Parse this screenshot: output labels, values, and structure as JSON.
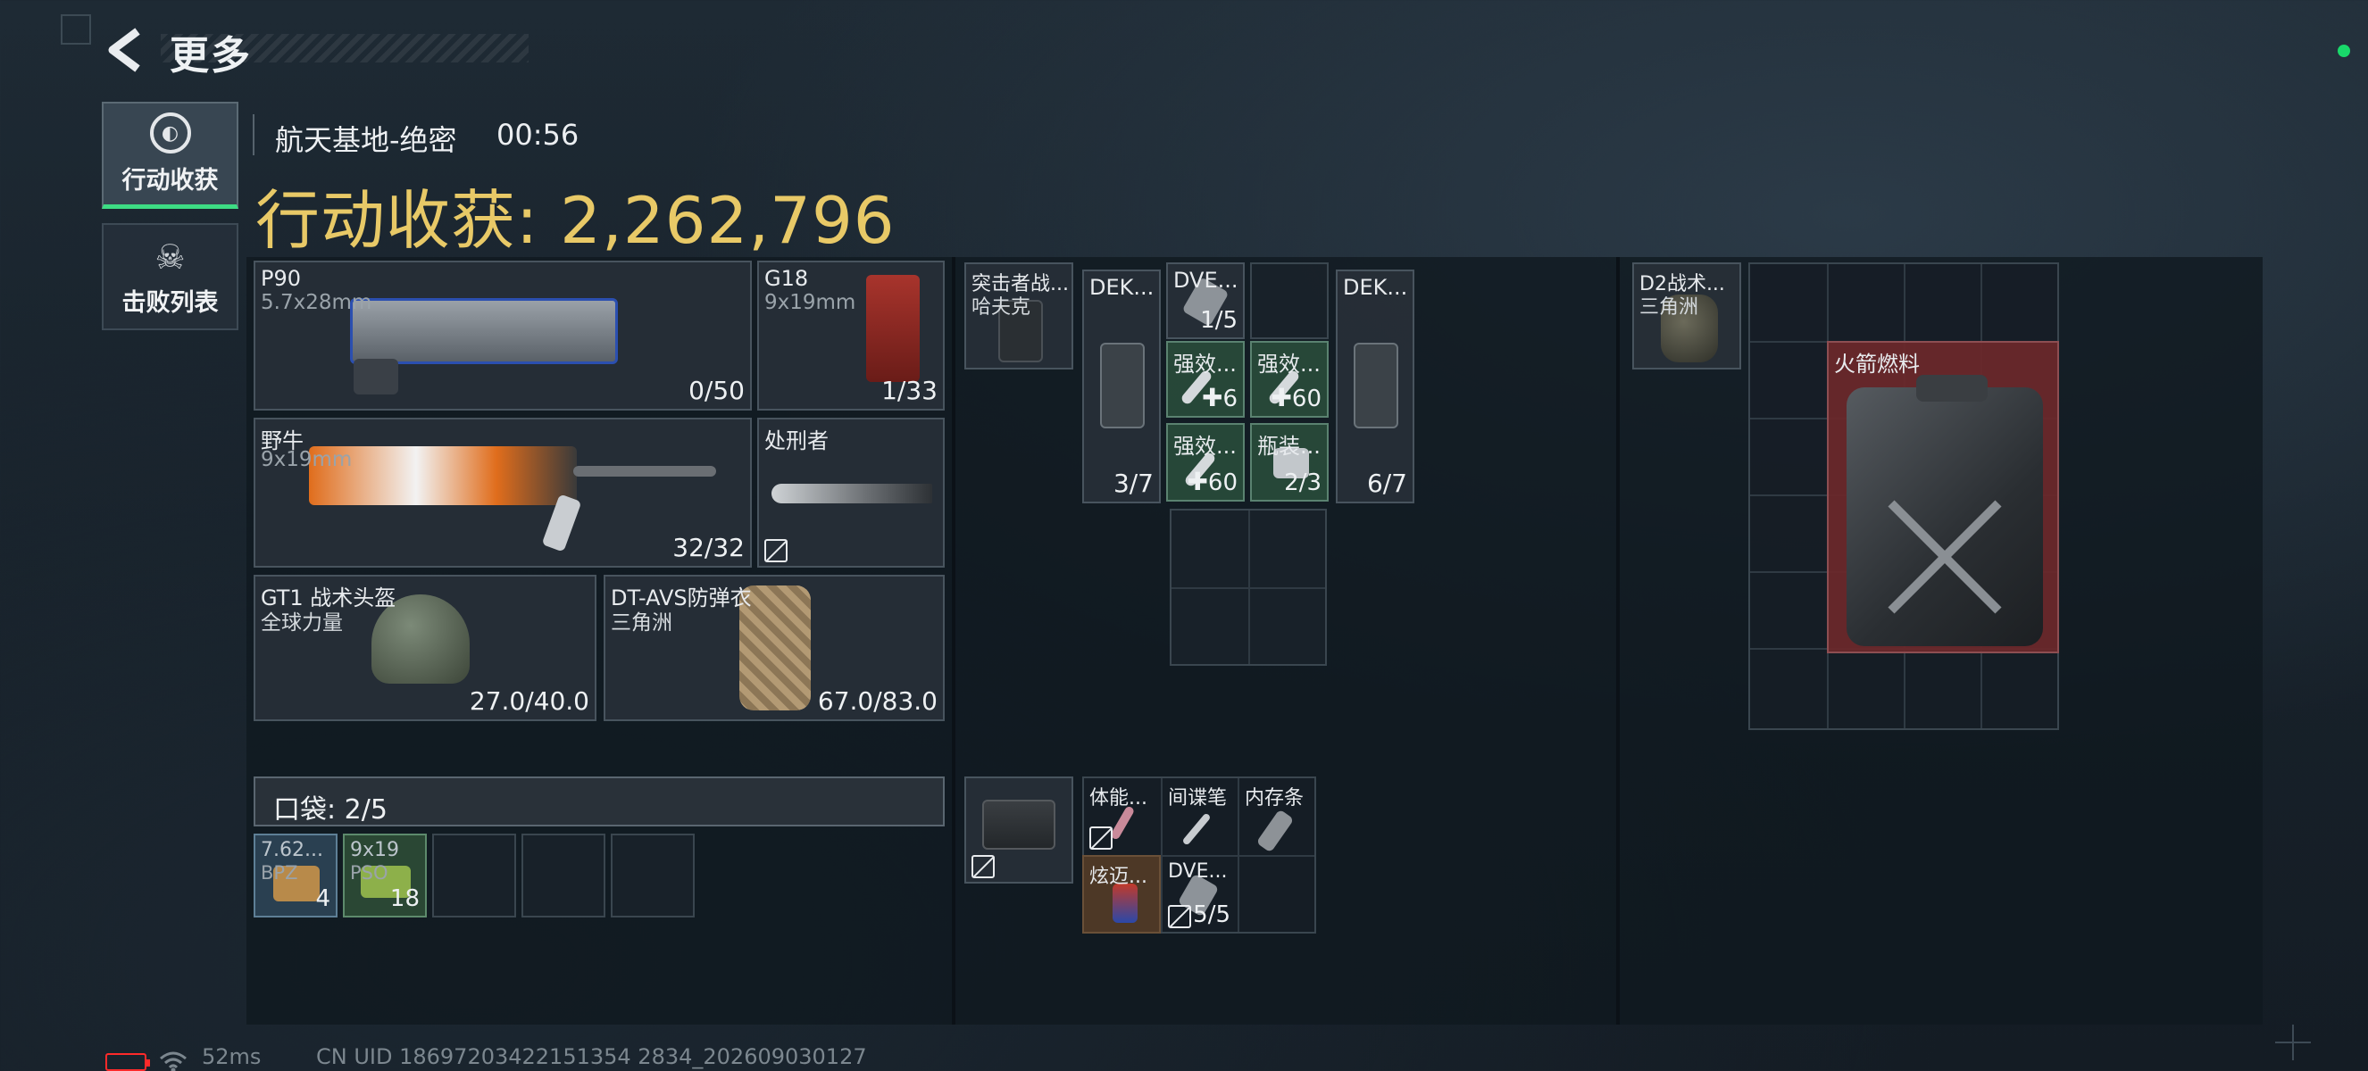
{
  "header": {
    "back_icon": "chevron-left-icon",
    "title": "更多"
  },
  "side_tabs": [
    {
      "label": "行动收获",
      "icon": "loot-icon",
      "active": true
    },
    {
      "label": "击败列表",
      "icon": "skull-icon",
      "active": false
    }
  ],
  "match": {
    "map": "航天基地-绝密",
    "time": "00:56"
  },
  "gains": {
    "title": "行动收获: 2,262,796"
  },
  "weapons": [
    {
      "name": "P90",
      "ammo": "5.7x28mm",
      "count": "0/50"
    },
    {
      "name": "G18",
      "ammo": "9x19mm",
      "count": "1/33"
    },
    {
      "name": "野牛",
      "ammo": "9x19mm",
      "count": "32/32"
    },
    {
      "name": "处刑者",
      "ammo": "",
      "count": ""
    }
  ],
  "armor": [
    {
      "name": "GT1 战术头盔",
      "maker": "全球力量",
      "durability": "27.0/40.0"
    },
    {
      "name": "DT-AVS防弹衣",
      "maker": "三角洲",
      "durability": "67.0/83.0"
    }
  ],
  "pocket": {
    "label": "口袋: 2/5",
    "items": [
      {
        "name": "7.62...",
        "sub": "BPZ",
        "count": "4"
      },
      {
        "name": "9x19",
        "sub": "PSO",
        "count": "18"
      }
    ]
  },
  "rig": {
    "name": "突击者战...",
    "maker": "哈夫克",
    "items": [
      {
        "name": "DEK...",
        "count": "3/7"
      },
      {
        "name": "DVE...",
        "count": "1/5"
      },
      {
        "name": "强效...",
        "count": "6"
      },
      {
        "name": "强效...",
        "count": "60"
      },
      {
        "name": "强效...",
        "count": "60"
      },
      {
        "name": "瓶装...",
        "count": "2/3"
      },
      {
        "name": "DEK...",
        "count": "6/7"
      }
    ]
  },
  "case": {
    "items": [
      {
        "name": "体能...",
        "count": ""
      },
      {
        "name": "间谍笔",
        "count": ""
      },
      {
        "name": "内存条",
        "count": ""
      },
      {
        "name": "炫迈...",
        "count": ""
      },
      {
        "name": "DVE...",
        "count": "5/5"
      }
    ]
  },
  "backpack": {
    "name": "D2战术...",
    "maker": "三角洲",
    "items": [
      {
        "name": "火箭燃料"
      }
    ]
  },
  "footer": {
    "ping": "52ms",
    "uid": "CN UID 18697203422151354 2834_202609030127"
  },
  "colors": {
    "gold": "#e8c967",
    "active_green": "#3ddc84",
    "battery_red": "#ff2a2a",
    "green_slot": "#284a3a",
    "red_slot": "#6c282a"
  }
}
